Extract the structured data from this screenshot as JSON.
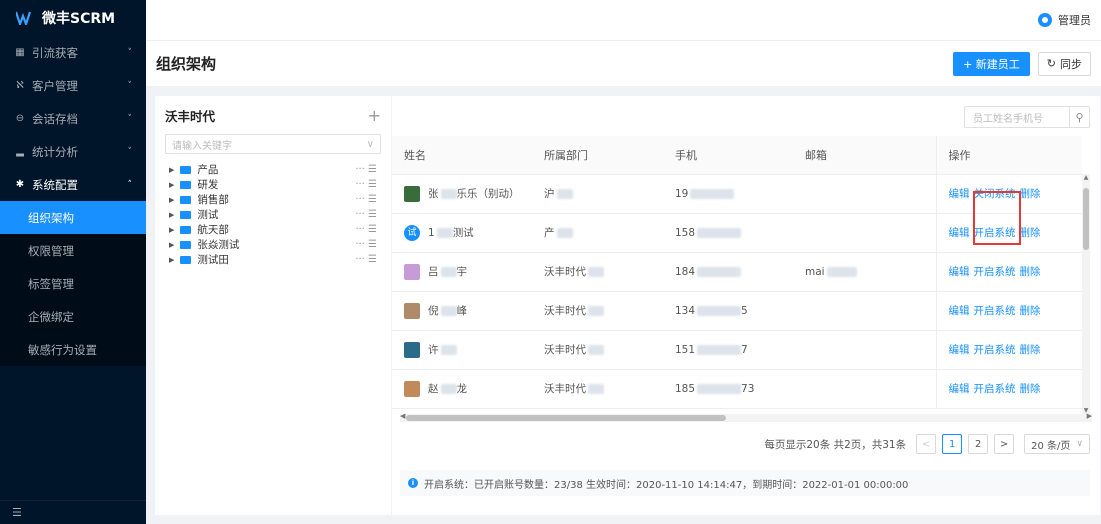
{
  "app": {
    "logo_text": "微丰SCRM",
    "brand_color": "#1890ff",
    "sidebar_bg": "#001529"
  },
  "sidebar": {
    "menu": [
      {
        "icon": "grid-icon",
        "glyph": "▦",
        "label": "引流获客",
        "arrow": "˅"
      },
      {
        "icon": "users-icon",
        "glyph": "ℵ",
        "label": "客户管理",
        "arrow": "˅"
      },
      {
        "icon": "chat-icon",
        "glyph": "⊖",
        "label": "会话存档",
        "arrow": "˅"
      },
      {
        "icon": "chart-icon",
        "glyph": "▂",
        "label": "统计分析",
        "arrow": "˅"
      },
      {
        "icon": "gear-icon",
        "glyph": "✱",
        "label": "系统配置",
        "arrow": "˄"
      }
    ],
    "submenu": [
      "组织架构",
      "权限管理",
      "标签管理",
      "企微绑定",
      "敏感行为设置"
    ],
    "footer_glyph": "☰"
  },
  "topbar": {
    "admin_name": "管理员"
  },
  "page": {
    "title": "组织架构",
    "new_button": "+ 新建员工",
    "sync_icon": "↻",
    "sync_button": "同步"
  },
  "tree": {
    "title": "沃丰时代",
    "plus": "+",
    "search_placeholder": "请输入关键字",
    "search_chevron": "∨",
    "nodes": [
      "产品",
      "研发",
      "销售部",
      "测试",
      "航天部",
      "张焱测试",
      "测试田"
    ],
    "node_more": "··· ☰"
  },
  "table": {
    "search_placeholder": "员工姓名手机号",
    "search_icon": "⚲",
    "columns": [
      "姓名",
      "所属部门",
      "手机",
      "邮箱",
      "操作"
    ],
    "rows": [
      {
        "name_a": "张",
        "name_b": "乐乐（别动）",
        "dept": "沪",
        "phone_a": "19",
        "phone_b": "",
        "mail": "",
        "toggle": "关闭系统",
        "avatar": "#3a6b3a",
        "avatar_text": ""
      },
      {
        "name_a": "1",
        "name_b": "测试",
        "dept": "产",
        "phone_a": "158",
        "phone_b": "",
        "mail": "",
        "toggle": "开启系统",
        "avatar": "#1890ff",
        "avatar_text": "试"
      },
      {
        "name_a": "吕",
        "name_b": "宇",
        "dept": "沃丰时代",
        "phone_a": "184",
        "phone_b": "",
        "mail": "mai",
        "toggle": "开启系统",
        "avatar": "#c79bd6",
        "avatar_text": ""
      },
      {
        "name_a": "倪",
        "name_b": "峰",
        "dept": "沃丰时代",
        "phone_a": "134",
        "phone_b": "5",
        "mail": "",
        "toggle": "开启系统",
        "avatar": "#b08b6a",
        "avatar_text": ""
      },
      {
        "name_a": "许",
        "name_b": "",
        "dept": "沃丰时代",
        "phone_a": "151",
        "phone_b": "7",
        "mail": "",
        "toggle": "开启系统",
        "avatar": "#2c6a8a",
        "avatar_text": ""
      },
      {
        "name_a": "赵",
        "name_b": "龙",
        "dept": "沃丰时代",
        "phone_a": "185",
        "phone_b": "73",
        "mail": "",
        "toggle": "开启系统",
        "avatar": "#c08a5a",
        "avatar_text": ""
      }
    ],
    "edit_label": "编辑",
    "delete_label": "删除"
  },
  "pager": {
    "summary": "每页显示20条 共2页，共31条",
    "prev": "<",
    "pages": [
      "1",
      "2"
    ],
    "next": ">",
    "page_size": "20 条/页",
    "chevron": "∨"
  },
  "info": {
    "glyph": "i",
    "text": "开启系统：已开启账号数量：23/38 生效时间：2020-11-10 14:14:47，到期时间：2022-01-01 00:00:00"
  }
}
